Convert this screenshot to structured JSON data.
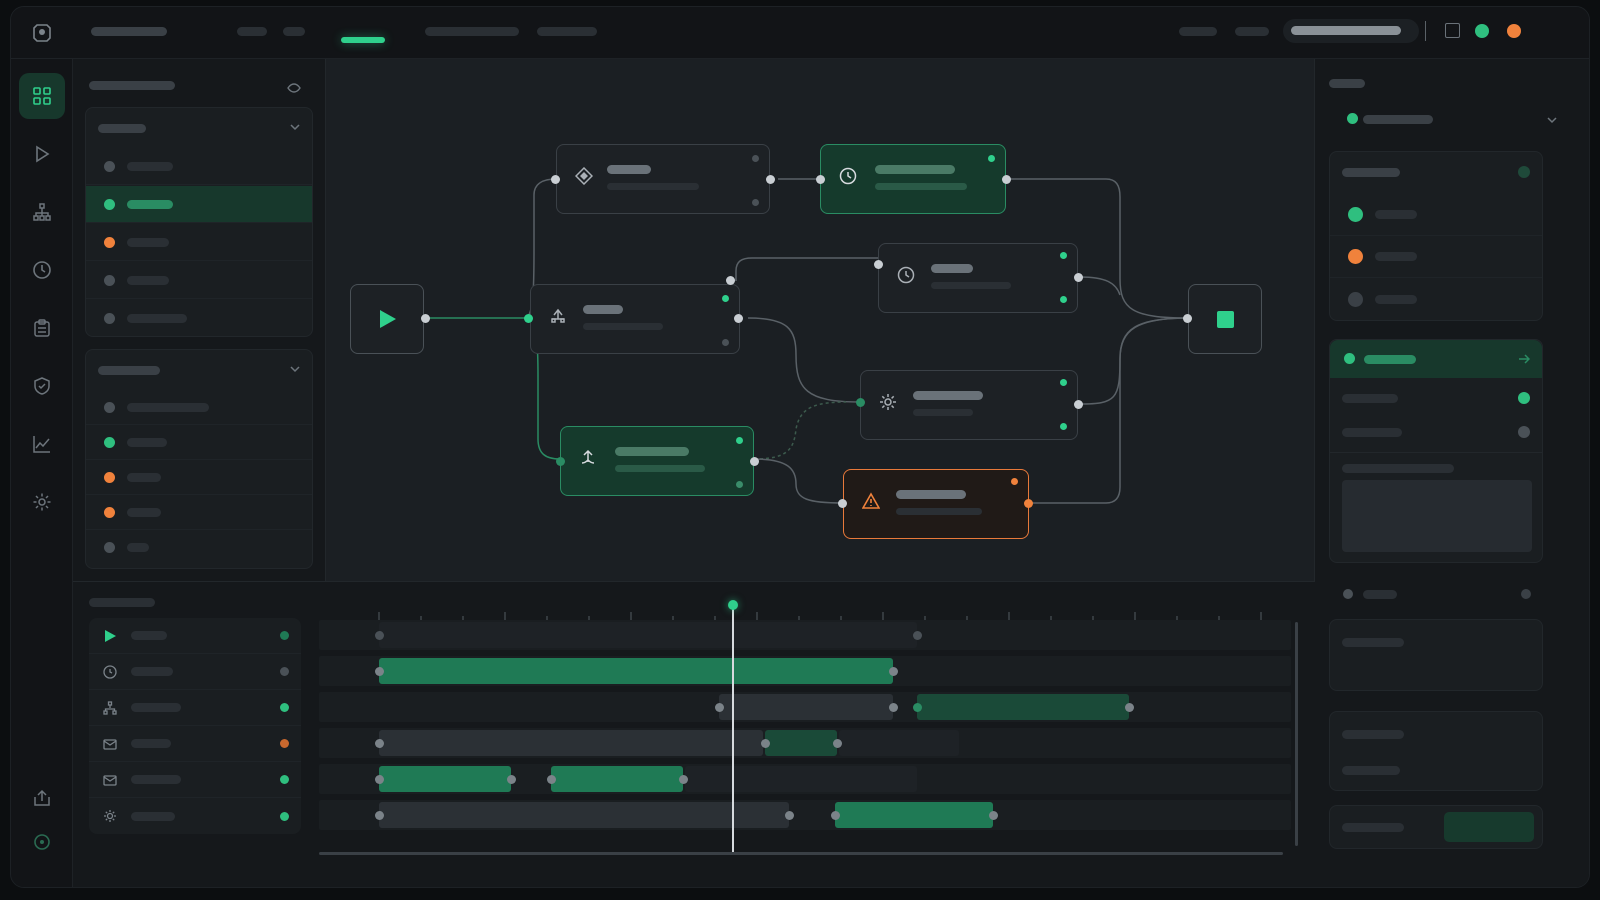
{
  "app": {
    "title": ""
  },
  "colors": {
    "accent": "#2fd08c",
    "warn": "#f0823c",
    "idle": "#4a5157"
  },
  "topbar": {
    "nav": [
      "",
      "",
      "",
      "",
      ""
    ],
    "active_tab": "",
    "search_placeholder": ""
  },
  "rail": {
    "icons": [
      "grid-icon",
      "play-icon",
      "hierarchy-icon",
      "clock-icon",
      "clipboard-icon",
      "shield-icon",
      "chart-icon",
      "gear-icon",
      "export-icon",
      "status-icon"
    ]
  },
  "left_panel": {
    "title": "",
    "group1": {
      "title": "",
      "items": [
        {
          "label": "",
          "status": "idle"
        },
        {
          "label": "",
          "status": "active"
        },
        {
          "label": "",
          "status": "warn"
        },
        {
          "label": "",
          "status": "idle"
        },
        {
          "label": "",
          "status": "idle"
        }
      ]
    },
    "group2": {
      "title": "",
      "items": [
        {
          "label": "",
          "status": "idle"
        },
        {
          "label": "",
          "status": "active"
        },
        {
          "label": "",
          "status": "warn"
        },
        {
          "label": "",
          "status": "warn"
        },
        {
          "label": "",
          "status": "idle"
        }
      ]
    }
  },
  "workflow": {
    "nodes": [
      {
        "id": "start",
        "icon": "play-icon",
        "state": "default",
        "title": "",
        "sub": ""
      },
      {
        "id": "n1",
        "icon": "diamond-icon",
        "state": "default",
        "title": "",
        "sub": ""
      },
      {
        "id": "n2",
        "icon": "timer-icon",
        "state": "success",
        "title": "",
        "sub": ""
      },
      {
        "id": "n3",
        "icon": "split-icon",
        "state": "default",
        "title": "",
        "sub": ""
      },
      {
        "id": "n4",
        "icon": "timer-icon",
        "state": "default",
        "title": "",
        "sub": ""
      },
      {
        "id": "n5",
        "icon": "gear-icon",
        "state": "default",
        "title": "",
        "sub": ""
      },
      {
        "id": "n6",
        "icon": "branch-icon",
        "state": "success",
        "title": "",
        "sub": ""
      },
      {
        "id": "n7",
        "icon": "warning-icon",
        "state": "warning",
        "title": "",
        "sub": ""
      },
      {
        "id": "end",
        "icon": "stop-icon",
        "state": "default",
        "title": "",
        "sub": ""
      }
    ]
  },
  "timeline": {
    "title": "",
    "rows": [
      {
        "icon": "play-icon",
        "label": "",
        "status": "active"
      },
      {
        "icon": "clock-icon",
        "label": "",
        "status": "idle"
      },
      {
        "icon": "hierarchy-icon",
        "label": "",
        "status": "active"
      },
      {
        "icon": "mail-icon",
        "label": "",
        "status": "warn"
      },
      {
        "icon": "mail-icon",
        "label": "",
        "status": "active"
      },
      {
        "icon": "gear-icon",
        "label": "",
        "status": "active"
      }
    ]
  },
  "right_panel": {
    "title": "",
    "selector": "",
    "status_list": [
      {
        "label": "",
        "status": "active"
      },
      {
        "label": "",
        "status": "warn"
      },
      {
        "label": "",
        "status": "idle"
      }
    ],
    "selected_item": "",
    "properties": [
      {
        "label": "",
        "value": ""
      },
      {
        "label": "",
        "value": ""
      }
    ],
    "notes_label": "",
    "notes": "",
    "footer_button": ""
  }
}
